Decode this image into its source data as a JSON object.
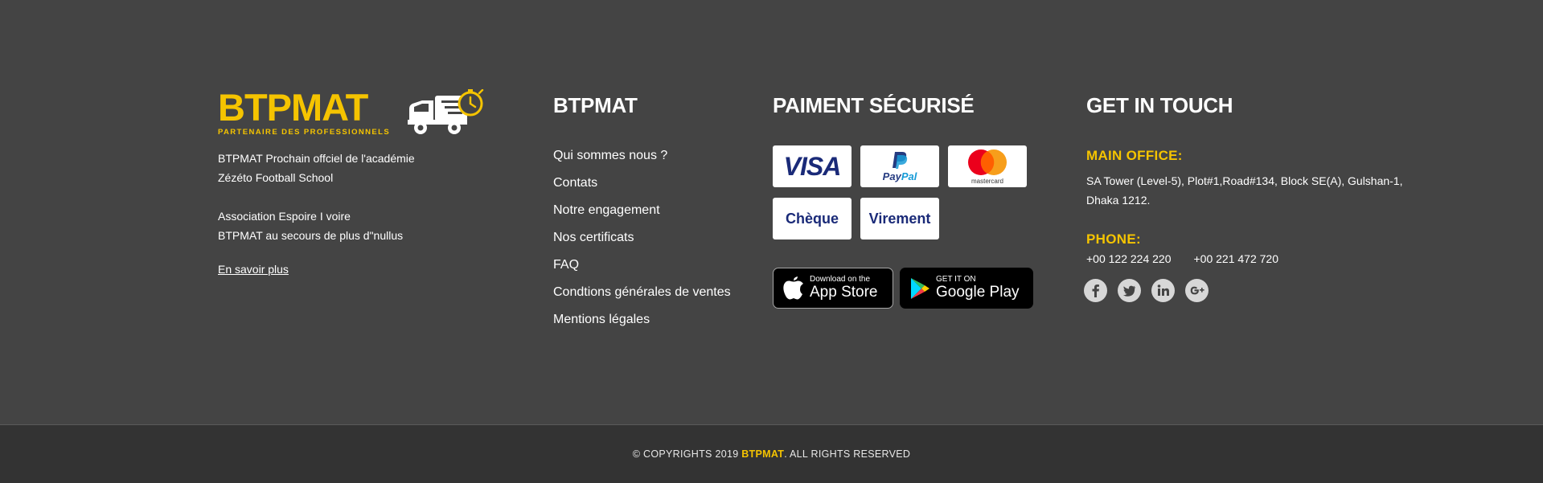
{
  "brand": {
    "name": "BTPMAT",
    "tagline": "PARTENAIRE DES PROFESSIONNELS",
    "accent_color": "#f5c400"
  },
  "about": {
    "line1": "BTPMAT Prochain offciel de l'académie",
    "line2": "Zézéto Football School",
    "line3": "Association Espoire I voire",
    "line4": "BTPMAT au secours de plus d\"nullus",
    "more_link": "En savoir plus"
  },
  "links_column": {
    "title": "BTPMAT",
    "items": [
      "Qui sommes nous ?",
      "Contats",
      "Notre engagement",
      "Nos certificats",
      "FAQ",
      "Condtions générales de ventes",
      "Mentions légales"
    ]
  },
  "payment": {
    "title": "PAIMENT SÉCURISÉ",
    "visa": "VISA",
    "paypal_pay": "Pay",
    "paypal_pal": "Pal",
    "mastercard": "mastercard",
    "cheque": "Chèque",
    "virement": "Virement",
    "appstore_small": "Download on the",
    "appstore_big": "App Store",
    "googleplay_small": "GET IT ON",
    "googleplay_big": "Google Play"
  },
  "contact": {
    "title": "GET IN TOUCH",
    "office_label": "MAIN OFFICE:",
    "address_line1": "SA Tower (Level-5), Plot#1,Road#134, Block SE(A), Gulshan-1,",
    "address_line2": "Dhaka 1212.",
    "phone_label": "PHONE:",
    "phone1": "+00 122 224 220",
    "phone2": "+00 221 472 720",
    "social_icons": [
      "facebook-icon",
      "twitter-icon",
      "linkedin-icon",
      "google-plus-icon"
    ]
  },
  "footer": {
    "copyright_prefix": "© COPYRIGHTS 2019 ",
    "copyright_brand": "BTPMAT",
    "copyright_suffix": ". ALL RIGHTS RESERVED"
  }
}
